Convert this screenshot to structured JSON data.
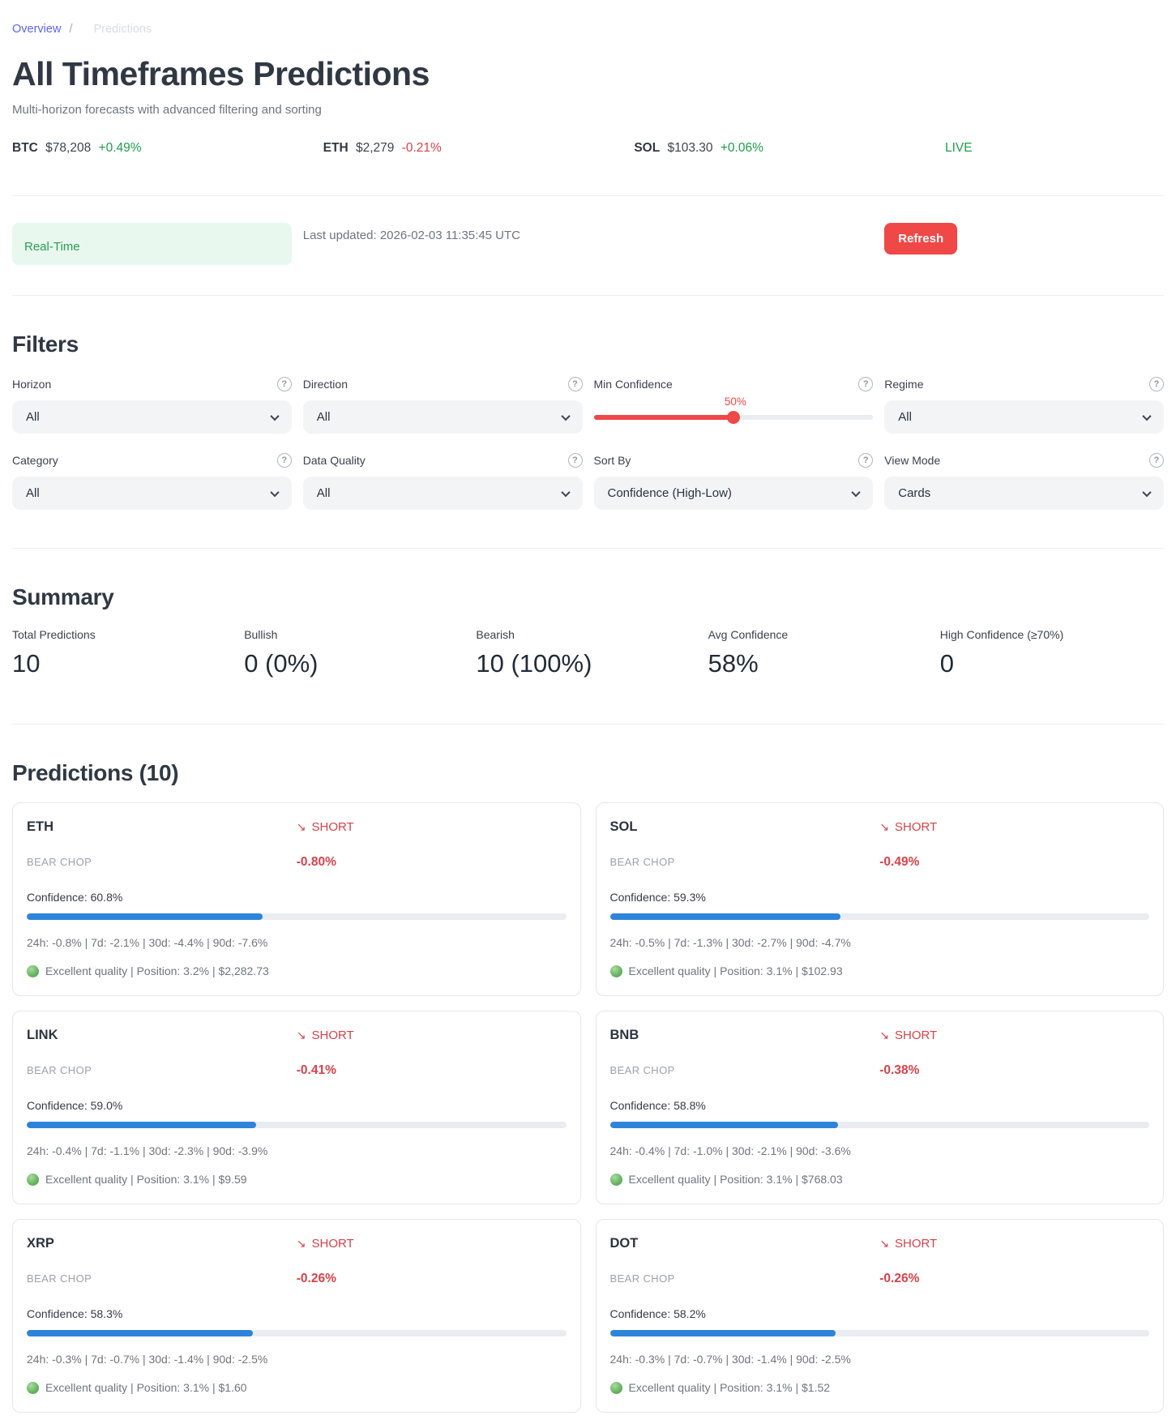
{
  "page": {
    "breadcrumb": {
      "overview": "Overview",
      "separator": "/",
      "current": "Predictions"
    },
    "title": "All Timeframes Predictions",
    "subtitle": "Multi-horizon forecasts with advanced filtering and sorting"
  },
  "ticker": {
    "items": [
      {
        "symbol": "BTC",
        "price": "$78,208",
        "change": "+0.49%",
        "direction": "up"
      },
      {
        "symbol": "ETH",
        "price": "$2,279",
        "change": "-0.21%",
        "direction": "down"
      },
      {
        "symbol": "SOL",
        "price": "$103.30",
        "change": "+0.06%",
        "direction": "up"
      }
    ],
    "live_label": "LIVE"
  },
  "status_bar": {
    "mode_badge": "Real-Time",
    "last_updated": "Last updated: 2026-02-03 11:35:45 UTC",
    "refresh_label": "Refresh"
  },
  "filters": {
    "title": "Filters",
    "help_glyph": "?",
    "controls": [
      {
        "label": "Horizon",
        "type": "select",
        "value": "All"
      },
      {
        "label": "Direction",
        "type": "select",
        "value": "All"
      },
      {
        "label": "Min Confidence",
        "type": "slider",
        "value": "50%",
        "percent": 50
      },
      {
        "label": "Regime",
        "type": "select",
        "value": "All"
      },
      {
        "label": "Category",
        "type": "select",
        "value": "All"
      },
      {
        "label": "Data Quality",
        "type": "select",
        "value": "All"
      },
      {
        "label": "Sort By",
        "type": "select",
        "value": "Confidence (High-Low)"
      },
      {
        "label": "View Mode",
        "type": "select",
        "value": "Cards"
      }
    ]
  },
  "summary": {
    "title": "Summary",
    "stats": [
      {
        "label": "Total Predictions",
        "value": "10"
      },
      {
        "label": "Bullish",
        "value": "0 (0%)"
      },
      {
        "label": "Bearish",
        "value": "10 (100%)"
      },
      {
        "label": "Avg Confidence",
        "value": "58%"
      },
      {
        "label": "High Confidence (≥70%)",
        "value": "0"
      }
    ]
  },
  "predictions": {
    "title": "Predictions (10)",
    "cards": [
      {
        "symbol": "ETH",
        "direction_arrow": "↘",
        "direction_label": "SHORT",
        "regime": "BEAR CHOP",
        "predicted_change": "-0.80%",
        "confidence_label": "Confidence: 60.8%",
        "confidence_value": 60.8,
        "timeframes": "24h: -0.8% | 7d: -2.1% | 30d: -4.4% | 90d: -7.6%",
        "quality": "Excellent quality | Position: 3.2% | $2,282.73"
      },
      {
        "symbol": "SOL",
        "direction_arrow": "↘",
        "direction_label": "SHORT",
        "regime": "BEAR CHOP",
        "predicted_change": "-0.49%",
        "confidence_label": "Confidence: 59.3%",
        "confidence_value": 59.3,
        "timeframes": "24h: -0.5% | 7d: -1.3% | 30d: -2.7% | 90d: -4.7%",
        "quality": "Excellent quality | Position: 3.1% | $102.93"
      },
      {
        "symbol": "LINK",
        "direction_arrow": "↘",
        "direction_label": "SHORT",
        "regime": "BEAR CHOP",
        "predicted_change": "-0.41%",
        "confidence_label": "Confidence: 59.0%",
        "confidence_value": 59.0,
        "timeframes": "24h: -0.4% | 7d: -1.1% | 30d: -2.3% | 90d: -3.9%",
        "quality": "Excellent quality | Position: 3.1% | $9.59"
      },
      {
        "symbol": "BNB",
        "direction_arrow": "↘",
        "direction_label": "SHORT",
        "regime": "BEAR CHOP",
        "predicted_change": "-0.38%",
        "confidence_label": "Confidence: 58.8%",
        "confidence_value": 58.8,
        "timeframes": "24h: -0.4% | 7d: -1.0% | 30d: -2.1% | 90d: -3.6%",
        "quality": "Excellent quality | Position: 3.1% | $768.03"
      },
      {
        "symbol": "XRP",
        "direction_arrow": "↘",
        "direction_label": "SHORT",
        "regime": "BEAR CHOP",
        "predicted_change": "-0.26%",
        "confidence_label": "Confidence: 58.3%",
        "confidence_value": 58.3,
        "timeframes": "24h: -0.3% | 7d: -0.7% | 30d: -1.4% | 90d: -2.5%",
        "quality": "Excellent quality | Position: 3.1% | $1.60"
      },
      {
        "symbol": "DOT",
        "direction_arrow": "↘",
        "direction_label": "SHORT",
        "regime": "BEAR CHOP",
        "predicted_change": "-0.26%",
        "confidence_label": "Confidence: 58.2%",
        "confidence_value": 58.2,
        "timeframes": "24h: -0.3% | 7d: -0.7% | 30d: -1.4% | 90d: -2.5%",
        "quality": "Excellent quality | Position: 3.1% | $1.52"
      }
    ]
  },
  "colors": {
    "accent_red": "#d7424a",
    "button_red": "#f04747",
    "positive_green": "#1c9e4b",
    "bar_blue": "#2d84da",
    "link_blue": "#5a65f2",
    "badge_green_bg": "#e8f8ee"
  }
}
